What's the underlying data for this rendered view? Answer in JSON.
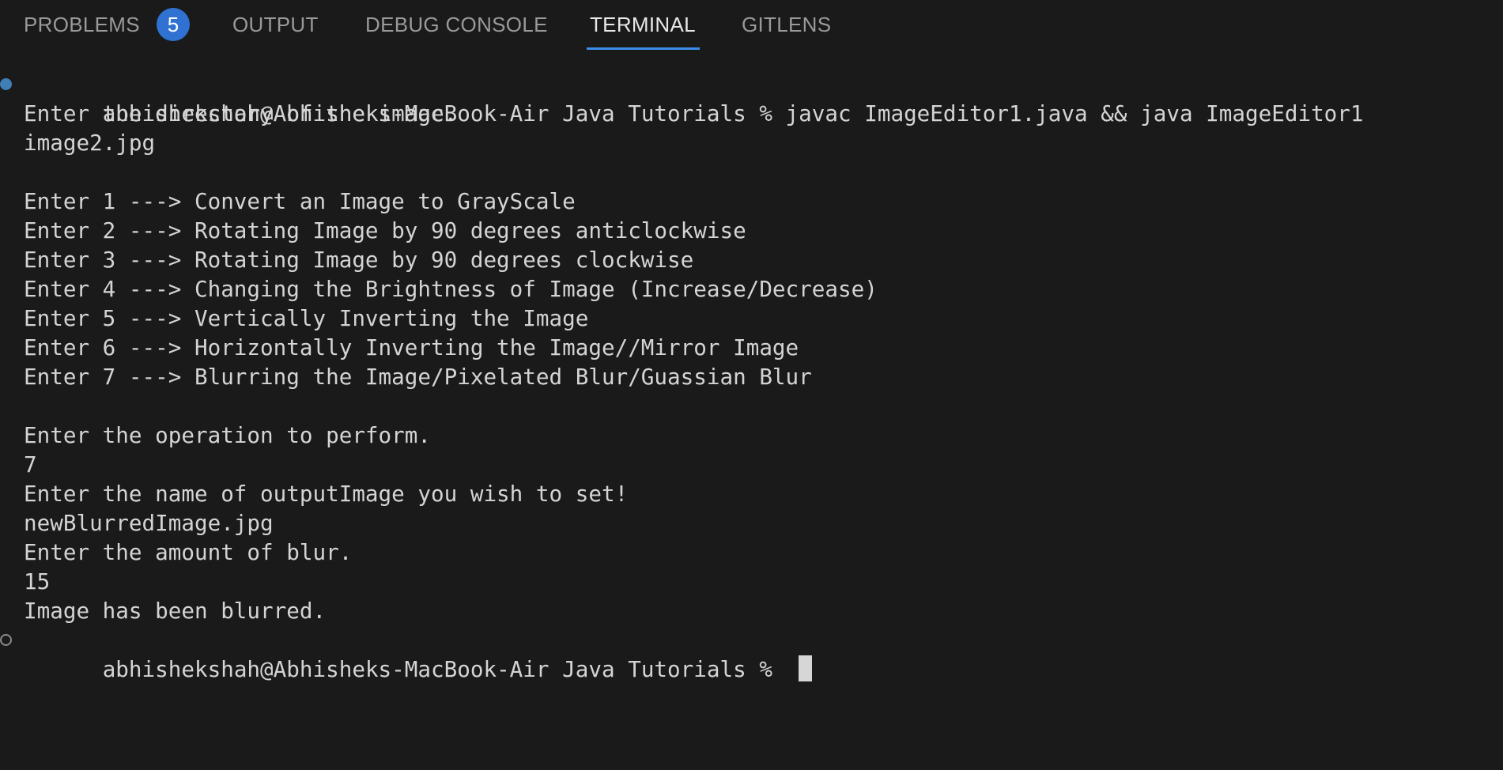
{
  "tabs": {
    "problems": "PROBLEMS",
    "problems_count": "5",
    "output": "OUTPUT",
    "debug_console": "DEBUG CONSOLE",
    "terminal": "TERMINAL",
    "gitlens": "GITLENS",
    "active": "TERMINAL",
    "accent_color": "#3b8eea"
  },
  "terminal": {
    "lines": [
      "abhishekshah@Abhisheks-MacBook-Air Java Tutorials % javac ImageEditor1.java && java ImageEditor1",
      "Enter the directory of the image.",
      "image2.jpg",
      "",
      "Enter 1 ---> Convert an Image to GrayScale",
      "Enter 2 ---> Rotating Image by 90 degrees anticlockwise",
      "Enter 3 ---> Rotating Image by 90 degrees clockwise",
      "Enter 4 ---> Changing the Brightness of Image (Increase/Decrease)",
      "Enter 5 ---> Vertically Inverting the Image",
      "Enter 6 ---> Horizontally Inverting the Image//Mirror Image",
      "Enter 7 ---> Blurring the Image/Pixelated Blur/Guassian Blur",
      "",
      "Enter the operation to perform.",
      "7",
      "Enter the name of outputImage you wish to set!",
      "newBlurredImage.jpg",
      "Enter the amount of blur.",
      "15",
      "Image has been blurred.",
      "abhishekshah@Abhisheks-MacBook-Air Java Tutorials % "
    ],
    "command_decoration_color": "#3f7fb5",
    "text_color": "#d4d4d4",
    "background_color": "#1a1a1a"
  }
}
